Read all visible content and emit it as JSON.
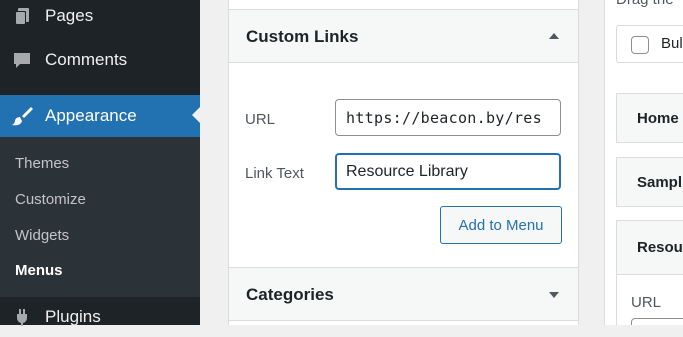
{
  "sidebar": {
    "items": [
      {
        "label": "Pages",
        "icon": "pages-icon"
      },
      {
        "label": "Comments",
        "icon": "comments-icon"
      },
      {
        "label": "Appearance",
        "icon": "appearance-brush-icon"
      },
      {
        "label": "Plugins",
        "icon": "plugins-icon"
      }
    ],
    "submenu": [
      "Themes",
      "Customize",
      "Widgets",
      "Menus"
    ],
    "current_submenu": "Menus"
  },
  "custom_links": {
    "title": "Custom Links",
    "url_label": "URL",
    "url_value": "https://beacon.by/res",
    "link_text_label": "Link Text",
    "link_text_value": "Resource Library",
    "add_button": "Add to Menu"
  },
  "categories": {
    "title": "Categories"
  },
  "menu_structure": {
    "drag_text": "Drag the",
    "bulk_label": "Bul",
    "items": [
      "Home",
      "Sampl",
      "Resour"
    ],
    "url_label": "URL"
  },
  "colors": {
    "sidebar_bg": "#1d2327",
    "accent": "#2271b1",
    "submenu_bg": "#2c3338"
  }
}
